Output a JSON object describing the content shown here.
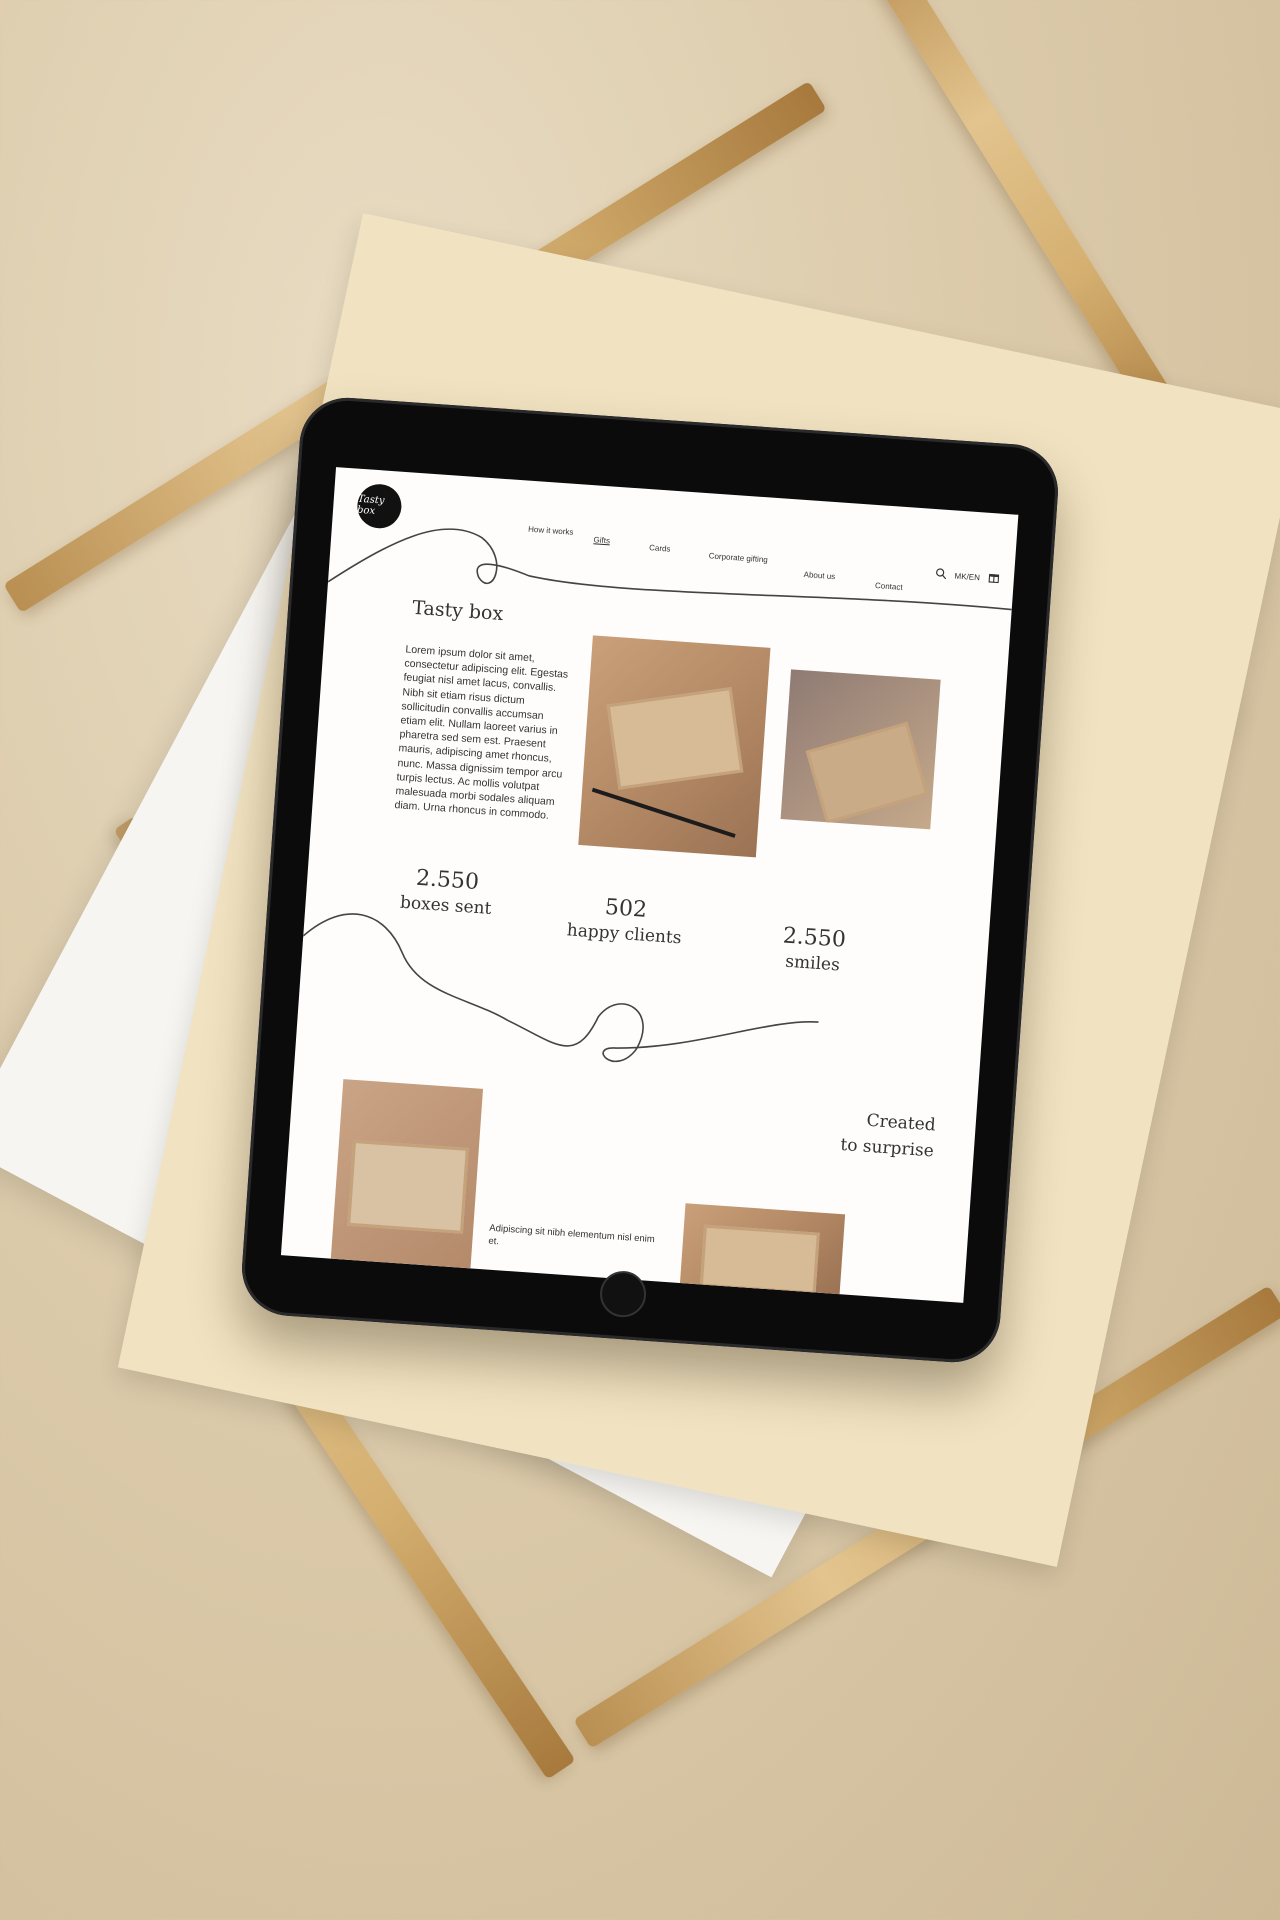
{
  "site": {
    "logo_text": "Tasty box",
    "nav": {
      "how_it_works": "How it works",
      "gifts": "Gifts",
      "cards": "Cards",
      "corporate_gifting": "Corporate gifting",
      "about_us": "About us",
      "contact": "Contact",
      "language": "MK/EN"
    },
    "icons": [
      "search-icon",
      "gift-icon"
    ],
    "hero": {
      "title": "Tasty box",
      "paragraph": "Lorem ipsum dolor sit amet, consectetur adipiscing elit. Egestas feugiat nisl amet lacus, convallis. Nibh sit etiam risus dictum sollicitudin convallis accumsan etiam elit. Nullam laoreet varius in pharetra sed sem est. Praesent mauris, adipiscing amet rhoncus, nunc. Massa dignissim tempor arcu turpis lectus. Ac mollis volutpat malesuada morbi sodales aliquam diam. Urna rhoncus in commodo."
    },
    "stats": [
      {
        "value": "2.550",
        "label": "boxes sent"
      },
      {
        "value": "502",
        "label": "happy clients"
      },
      {
        "value": "2.550",
        "label": "smiles"
      }
    ],
    "created_section": {
      "line1": "Created",
      "line2": "to surprise",
      "text": "Adipiscing sit nibh elementum nisl enim et."
    }
  }
}
